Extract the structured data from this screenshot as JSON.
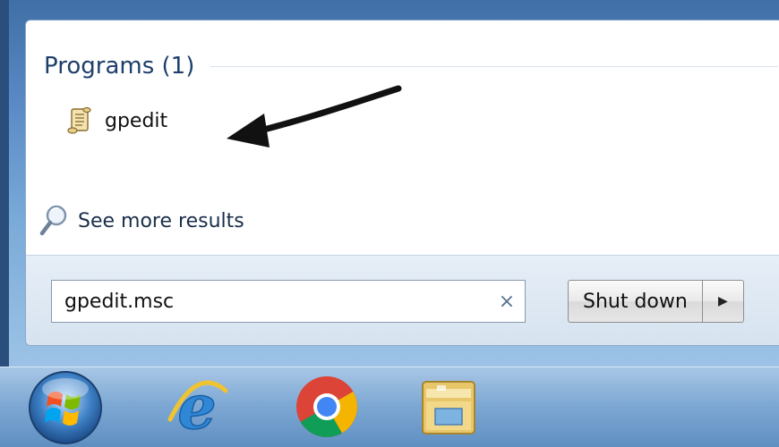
{
  "results": {
    "section_title": "Programs (1)",
    "program": {
      "label": "gpedit",
      "icon": "script-icon"
    },
    "see_more": {
      "label": "See more results",
      "icon": "search-magnifier-icon"
    }
  },
  "search": {
    "value": "gpedit.msc",
    "clear_icon": "×"
  },
  "shutdown": {
    "label": "Shut down",
    "arrow": "▶"
  },
  "taskbar": {
    "items": [
      "start-orb",
      "internet-explorer-icon",
      "chrome-icon",
      "windows-explorer-icon"
    ]
  },
  "annotation": {
    "arrow_color": "#111111"
  },
  "colors": {
    "accent": "#1e3f6b",
    "frame": "#5b8cc6"
  }
}
